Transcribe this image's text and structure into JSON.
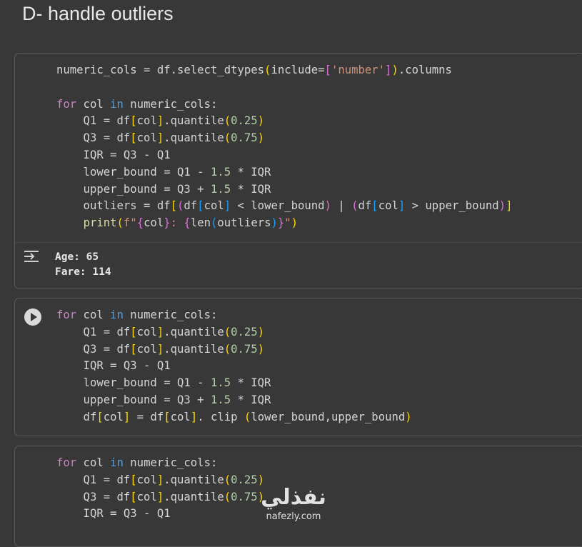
{
  "section_title": "D- handle outliers",
  "cell1": {
    "code": [
      "numeric_cols = df.select_dtypes(include=['number']).columns",
      "",
      "for col in numeric_cols:",
      "    Q1 = df[col].quantile(0.25)",
      "    Q3 = df[col].quantile(0.75)",
      "    IQR = Q3 - Q1",
      "    lower_bound = Q1 - 1.5 * IQR",
      "    upper_bound = Q3 + 1.5 * IQR",
      "    outliers = df[(df[col] < lower_bound) | (df[col] > upper_bound)]",
      "    print(f\"{col}: {len(outliers)}\")"
    ],
    "output": [
      "Age: 65",
      "Fare: 114"
    ],
    "output_icon": "output-toggle-icon"
  },
  "cell2": {
    "code": [
      "for col in numeric_cols:",
      "    Q1 = df[col].quantile(0.25)",
      "    Q3 = df[col].quantile(0.75)",
      "    IQR = Q3 - Q1",
      "    lower_bound = Q1 - 1.5 * IQR",
      "    upper_bound = Q3 + 1.5 * IQR",
      "    df[col] = df[col]. clip (lower_bound,upper_bound)"
    ],
    "run_icon": "play-icon"
  },
  "cell3": {
    "code": [
      "for col in numeric_cols:",
      "    Q1 = df[col].quantile(0.25)",
      "    Q3 = df[col].quantile(0.75)",
      "    IQR = Q3 - Q1"
    ]
  },
  "watermark": {
    "arabic": "نفذلي",
    "latin": "nafezly.com"
  },
  "colors": {
    "background": "#383838",
    "border": "#5a5a5a",
    "keyword": "#c586c0",
    "number": "#b5cea8",
    "string": "#ce9178"
  }
}
